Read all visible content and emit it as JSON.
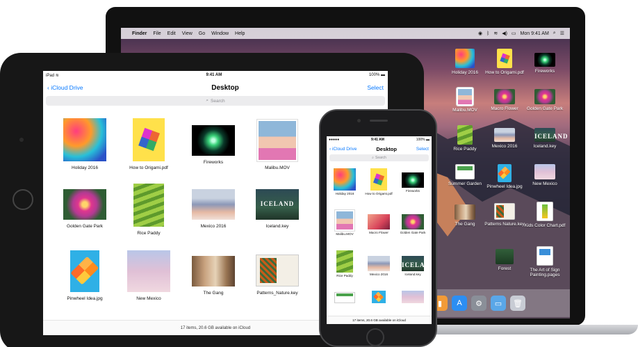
{
  "mac": {
    "menubar": {
      "apple_icon": "apple-logo-icon",
      "items": [
        "Finder",
        "File",
        "Edit",
        "View",
        "Go",
        "Window",
        "Help"
      ],
      "clock": "Mon 9:41 AM"
    },
    "desktop_icons": [
      {
        "label": "Holiday 2016",
        "art": "art-holiday"
      },
      {
        "label": "How to Origami.pdf",
        "art": "art-origami"
      },
      {
        "label": "Fireworks",
        "art": "art-fireworks"
      },
      {
        "label": "Malibu.MOV",
        "art": "art-malibu"
      },
      {
        "label": "Macro Flower",
        "art": "art-goldengate"
      },
      {
        "label": "Golden Gate Park",
        "art": "art-goldengate"
      },
      {
        "label": "Rice Paddy",
        "art": "art-rice"
      },
      {
        "label": "Mexico 2016",
        "art": "art-mexico"
      },
      {
        "label": "Iceland.key",
        "art": "art-iceland"
      },
      {
        "label": "Summer Garden",
        "art": "art-summer"
      },
      {
        "label": "Pinwheel Idea.jpg",
        "art": "art-pinwheel"
      },
      {
        "label": "New Mexico",
        "art": "art-newmexico"
      },
      {
        "label": "The Gang",
        "art": "art-gang"
      },
      {
        "label": "Patterns Nature.key",
        "art": "art-patterns"
      },
      {
        "label": "Kids Color Chart.pdf",
        "art": "art-kids"
      },
      {
        "label": "Forest",
        "art": "art-forest"
      },
      {
        "label": "The Art of Sign Painting.pages",
        "art": "art-art"
      }
    ],
    "dock_icons": [
      "books-icon",
      "app-store-icon",
      "system-preferences-icon",
      "downloads-folder-icon",
      "trash-icon"
    ]
  },
  "ipad": {
    "status": {
      "left": "iPad",
      "time": "9:41 AM",
      "battery": "100%"
    },
    "nav": {
      "back": "iCloud Drive",
      "title": "Desktop",
      "select": "Select"
    },
    "search_placeholder": "Search",
    "files": [
      {
        "label": "Holiday 2016",
        "art": "art-holiday"
      },
      {
        "label": "How to Origami.pdf",
        "art": "art-origami"
      },
      {
        "label": "Fireworks",
        "art": "art-fireworks"
      },
      {
        "label": "Malibu.MOV",
        "art": "art-malibu"
      },
      {
        "label": "Golden Gate Park",
        "art": "art-goldengate"
      },
      {
        "label": "Rice Paddy",
        "art": "art-rice"
      },
      {
        "label": "Mexico 2016",
        "art": "art-mexico"
      },
      {
        "label": "Iceland.key",
        "art": "art-iceland"
      },
      {
        "label": "Pinwheel Idea.jpg",
        "art": "art-pinwheel"
      },
      {
        "label": "New Mexico",
        "art": "art-newmexico"
      },
      {
        "label": "The Gang",
        "art": "art-gang"
      },
      {
        "label": "Patterns_Nature.key",
        "art": "art-patterns"
      }
    ],
    "footer": "17 items, 20.6 GB available on iCloud"
  },
  "iphone": {
    "status": {
      "left": "●●●●● ",
      "time": "9:41 AM",
      "battery": "100%"
    },
    "nav": {
      "back": "iCloud Drive",
      "title": "Desktop",
      "select": "Select"
    },
    "search_placeholder": "Search",
    "files": [
      {
        "label": "Holiday 2016",
        "art": "art-holiday"
      },
      {
        "label": "How to Origami.pdf",
        "art": "art-origami"
      },
      {
        "label": "Fireworks",
        "art": "art-fireworks"
      },
      {
        "label": "Malibu.MOV",
        "art": "art-malibu"
      },
      {
        "label": "Macro Flower",
        "art": "art-mexico"
      },
      {
        "label": "Golden Gate Park",
        "art": "art-goldengate"
      },
      {
        "label": "Rice Paddy",
        "art": "art-rice"
      },
      {
        "label": "Mexico 2016",
        "art": "art-mexico"
      },
      {
        "label": "Iceland.key",
        "art": "art-iceland"
      },
      {
        "label": "",
        "art": "art-summer"
      },
      {
        "label": "",
        "art": "art-pinwheel"
      },
      {
        "label": "",
        "art": "art-newmexico"
      }
    ],
    "footer": "17 items, 20.6 GB available on iCloud"
  }
}
